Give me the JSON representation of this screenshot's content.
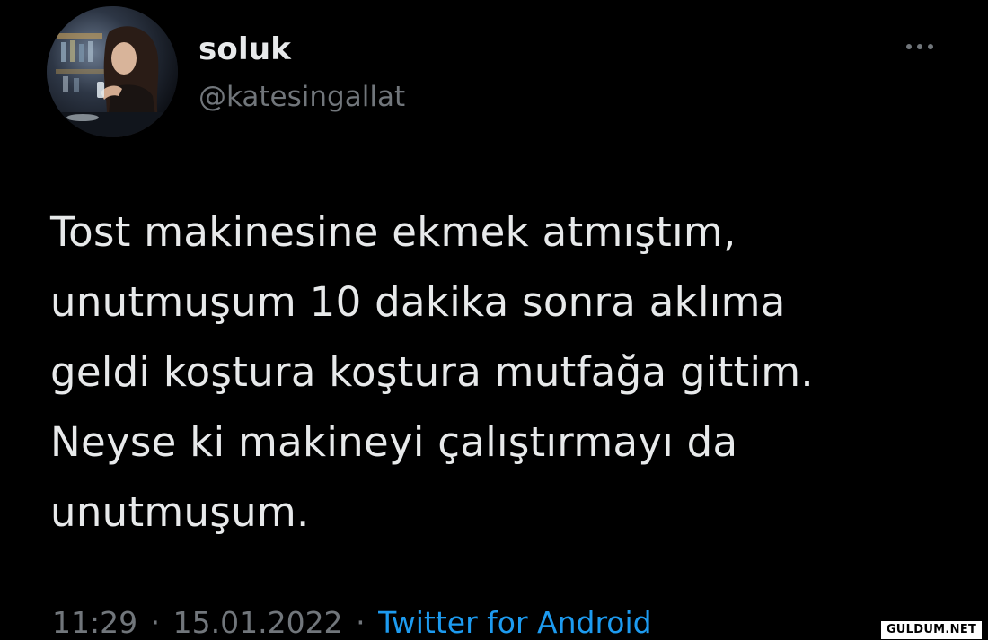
{
  "tweet": {
    "display_name": "soluk",
    "handle": "@katesingallat",
    "text": "Tost makinesine ekmek atmıştım,\nunutmuşum 10 dakika sonra aklıma\ngeldi koştura koştura mutfağa gittim.\nNeyse ki makineyi çalıştırmayı da\nunutmuşum.",
    "time": "11:29",
    "date": "15.01.2022",
    "separator": "·",
    "source": "Twitter for Android",
    "more_icon": "more-horizontal-icon"
  },
  "watermark": {
    "text": "GULDUM.NET"
  },
  "colors": {
    "background": "#000000",
    "primary_text": "#e7e9ea",
    "secondary_text": "#71767b",
    "link": "#1d9bf0"
  }
}
